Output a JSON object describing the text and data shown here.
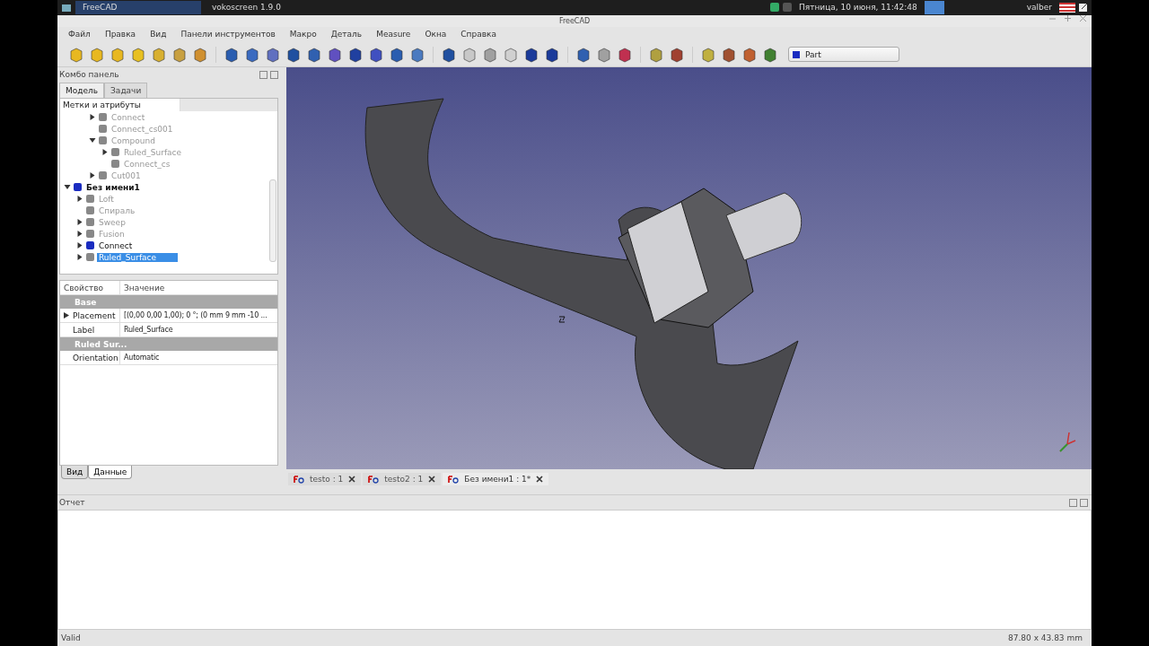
{
  "taskbar": {
    "tasks": [
      {
        "label": "FreeCAD",
        "selected": true
      },
      {
        "label": "vokoscreen 1.9.0",
        "selected": false
      }
    ],
    "clock": "Пятница, 10 июня, 11:42:48",
    "user": "valber"
  },
  "window": {
    "title": "FreeCAD"
  },
  "menu": [
    "Файл",
    "Правка",
    "Вид",
    "Панели инструментов",
    "Макро",
    "Деталь",
    "Measure",
    "Окна",
    "Справка"
  ],
  "workbench": {
    "value": "Part"
  },
  "combo_panel": {
    "title": "Комбо панель",
    "tabs": [
      {
        "label": "Модель",
        "selected": true
      },
      {
        "label": "Задачи",
        "selected": false
      }
    ],
    "tree": {
      "header": "Метки и атрибуты",
      "continued": [
        {
          "label": "Connect",
          "kind": "branch",
          "expanded": false,
          "visible": false,
          "selected": false
        },
        {
          "label": "Connect_cs001",
          "kind": "leaf",
          "visible": false,
          "selected": false
        },
        {
          "label": "Compound",
          "kind": "branch",
          "expanded": true,
          "visible": false,
          "selected": false,
          "children": [
            {
              "label": "Ruled_Surface",
              "kind": "branch",
              "expanded": false,
              "visible": false,
              "selected": false
            },
            {
              "label": "Connect_cs",
              "kind": "leaf",
              "visible": false,
              "selected": false
            }
          ]
        },
        {
          "label": "Cut001",
          "kind": "branch",
          "expanded": false,
          "visible": false,
          "selected": false
        }
      ],
      "items": [
        {
          "label": "Без имени1",
          "kind": "document",
          "expanded": true,
          "selected": false,
          "children": [
            {
              "label": "Loft",
              "kind": "branch",
              "expanded": false,
              "visible": false,
              "selected": false
            },
            {
              "label": "Спираль",
              "kind": "leaf",
              "visible": false,
              "selected": false
            },
            {
              "label": "Sweep",
              "kind": "branch",
              "expanded": false,
              "visible": false,
              "selected": false
            },
            {
              "label": "Fusion",
              "kind": "branch",
              "expanded": false,
              "visible": false,
              "selected": false
            },
            {
              "label": "Connect",
              "kind": "branch",
              "expanded": false,
              "visible": true,
              "selected": false
            },
            {
              "label": "Ruled_Surface",
              "kind": "branch",
              "expanded": false,
              "visible": false,
              "selected": true
            }
          ]
        }
      ]
    },
    "properties": {
      "columns": [
        "Свойство",
        "Значение"
      ],
      "rows": [
        {
          "kind": "group",
          "name": "Base"
        },
        {
          "kind": "property",
          "name": "Placement",
          "value": "[(0,00 0,00 1,00); 0 °; (0 mm  9 mm  -10 ...",
          "expandable": true
        },
        {
          "kind": "property",
          "name": "Label",
          "value": "Ruled_Surface",
          "expandable": false
        },
        {
          "kind": "group",
          "name": "Ruled  Sur..."
        },
        {
          "kind": "property",
          "name": "Orientation",
          "value": "Automatic",
          "expandable": false
        }
      ]
    },
    "bottom_tabs": [
      {
        "label": "Вид",
        "selected": false
      },
      {
        "label": "Данные",
        "selected": true
      }
    ]
  },
  "document_tabs": [
    {
      "label": "testo : 1",
      "selected": false
    },
    {
      "label": "testo2 : 1",
      "selected": false
    },
    {
      "label": "Без имени1 : 1*",
      "selected": true
    }
  ],
  "report": {
    "title": "Отчет"
  },
  "status_bar": {
    "message": "Valid",
    "dimensions": "87.80 x 43.83 mm"
  }
}
